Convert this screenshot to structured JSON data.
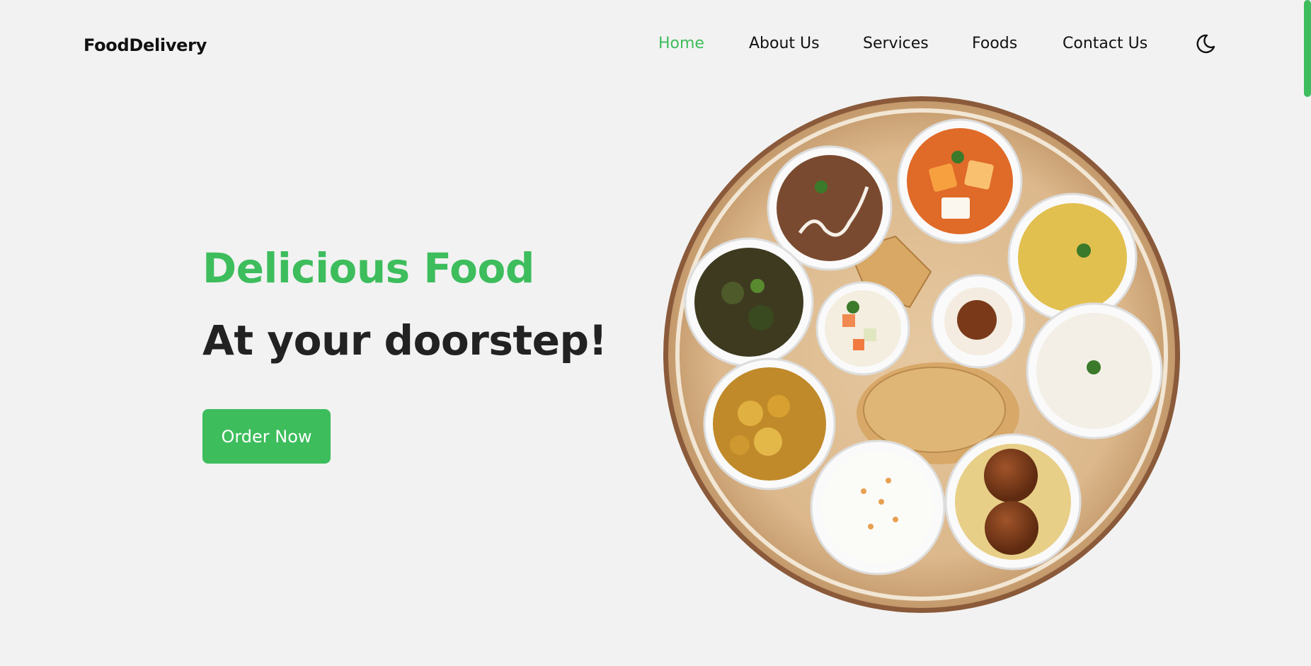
{
  "logo": "FoodDelivery",
  "nav": [
    {
      "label": "Home",
      "active": true
    },
    {
      "label": "About Us",
      "active": false
    },
    {
      "label": "Services",
      "active": false
    },
    {
      "label": "Foods",
      "active": false
    },
    {
      "label": "Contact Us",
      "active": false
    }
  ],
  "theme_toggle_icon": "moon-icon",
  "hero": {
    "title": "Delicious Food",
    "subtitle": "At your doorstep!",
    "button_label": "Order Now"
  },
  "hero_image_icon": "thali-plate-illustration",
  "colors": {
    "accent": "#3dbd5c",
    "background": "#f2f2f2",
    "text": "#222222"
  }
}
